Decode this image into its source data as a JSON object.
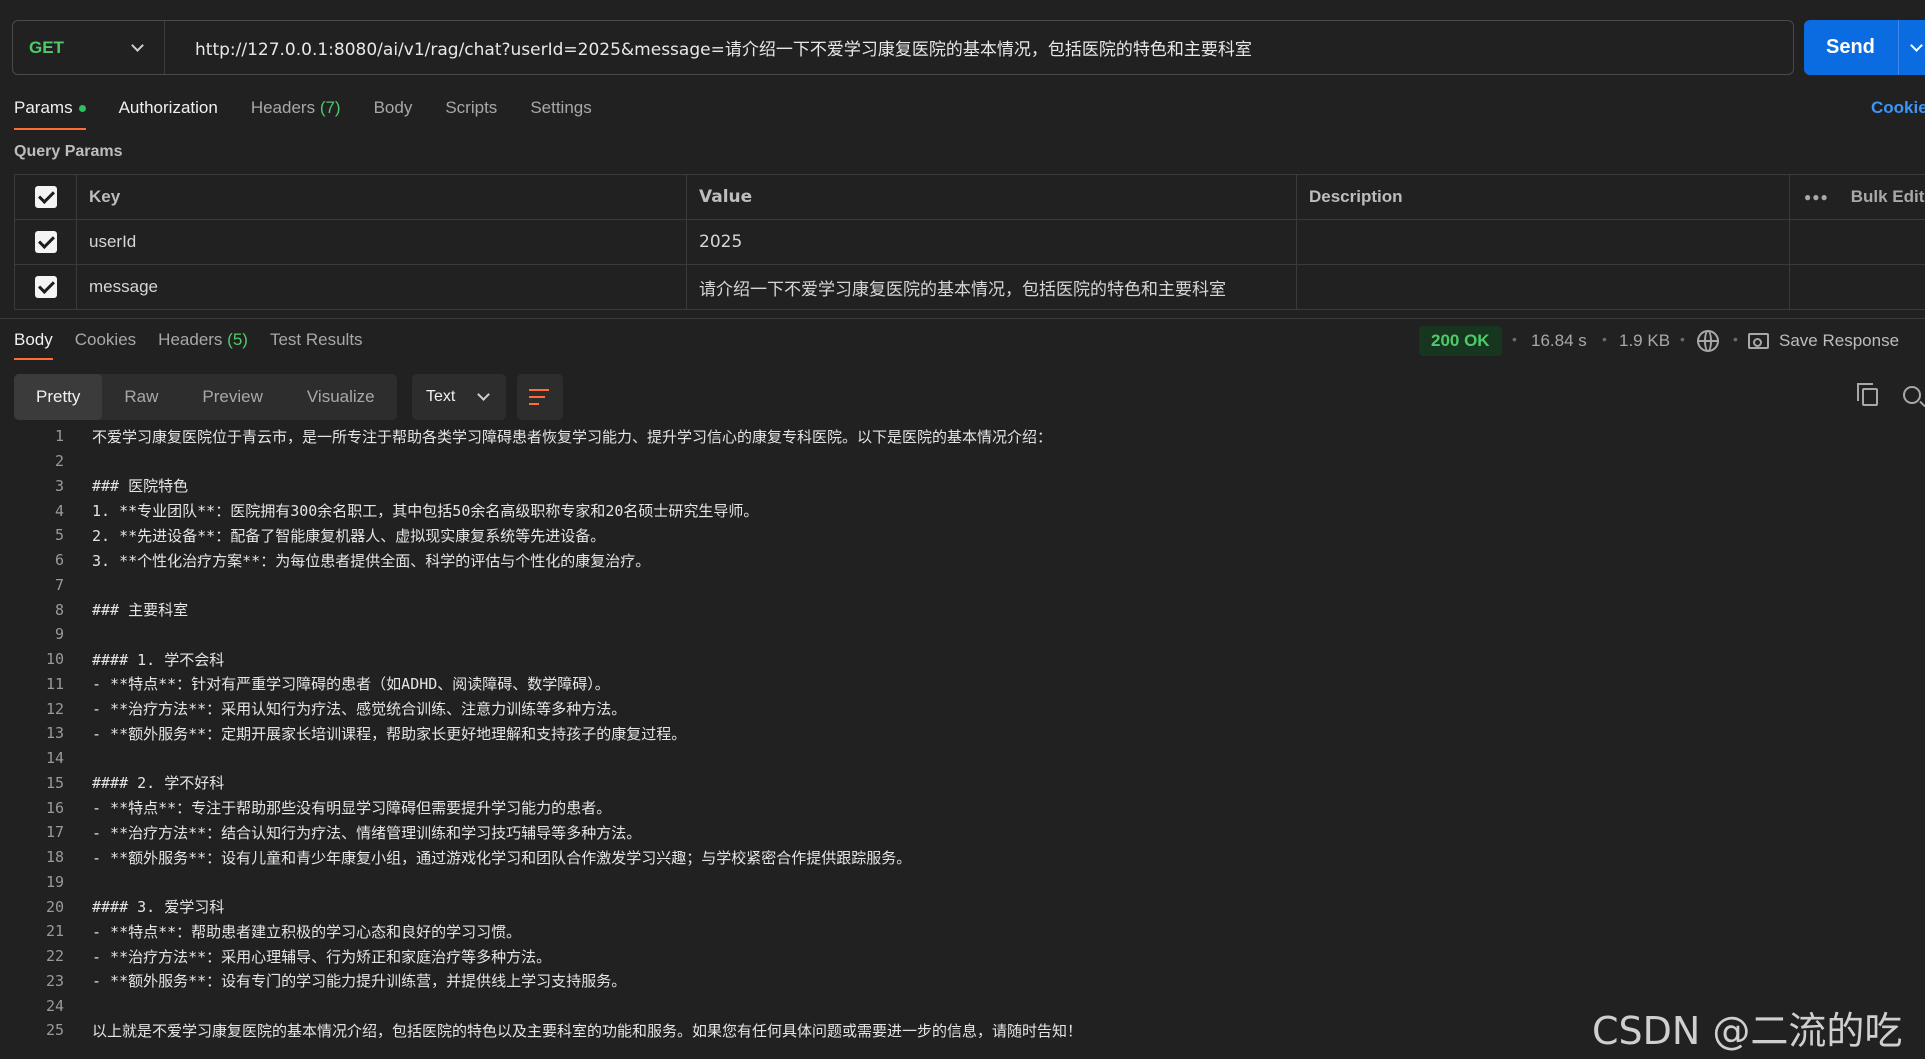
{
  "request": {
    "method": "GET",
    "url": "http://127.0.0.1:8080/ai/v1/rag/chat?userId=2025&message=请介绍一下不爱学习康复医院的基本情况，包括医院的特色和主要科室",
    "send_label": "Send"
  },
  "request_tabs": {
    "params": "Params",
    "authorization": "Authorization",
    "headers": "Headers",
    "headers_count": "(7)",
    "body": "Body",
    "scripts": "Scripts",
    "settings": "Settings",
    "cookies": "Cookie"
  },
  "query_params": {
    "title": "Query Params",
    "columns": {
      "key": "Key",
      "value": "Value",
      "description": "Description",
      "bulk_edit": "Bulk Edit"
    },
    "rows": [
      {
        "key": "userId",
        "value": "2025",
        "description": ""
      },
      {
        "key": "message",
        "value": "请介绍一下不爱学习康复医院的基本情况，包括医院的特色和主要科室",
        "description": ""
      }
    ]
  },
  "response_tabs": {
    "body": "Body",
    "cookies": "Cookies",
    "headers": "Headers",
    "headers_count": "(5)",
    "test_results": "Test Results"
  },
  "response_meta": {
    "status": "200 OK",
    "time": "16.84 s",
    "size": "1.9 KB",
    "save_response": "Save Response"
  },
  "view": {
    "pretty": "Pretty",
    "raw": "Raw",
    "preview": "Preview",
    "visualize": "Visualize",
    "format": "Text"
  },
  "code_lines": [
    "不爱学习康复医院位于青云市，是一所专注于帮助各类学习障碍患者恢复学习能力、提升学习信心的康复专科医院。以下是医院的基本情况介绍：",
    "",
    "### 医院特色",
    "1. **专业团队**：医院拥有300余名职工，其中包括50余名高级职称专家和20名硕士研究生导师。",
    "2. **先进设备**：配备了智能康复机器人、虚拟现实康复系统等先进设备。",
    "3. **个性化治疗方案**：为每位患者提供全面、科学的评估与个性化的康复治疗。",
    "",
    "### 主要科室",
    "",
    "#### 1. 学不会科",
    "- **特点**：针对有严重学习障碍的患者（如ADHD、阅读障碍、数学障碍）。",
    "- **治疗方法**：采用认知行为疗法、感觉统合训练、注意力训练等多种方法。",
    "- **额外服务**：定期开展家长培训课程，帮助家长更好地理解和支持孩子的康复过程。",
    "",
    "#### 2. 学不好科",
    "- **特点**：专注于帮助那些没有明显学习障碍但需要提升学习能力的患者。",
    "- **治疗方法**：结合认知行为疗法、情绪管理训练和学习技巧辅导等多种方法。",
    "- **额外服务**：设有儿童和青少年康复小组，通过游戏化学习和团队合作激发学习兴趣；与学校紧密合作提供跟踪服务。",
    "",
    "#### 3. 爱学习科",
    "- **特点**：帮助患者建立积极的学习心态和良好的学习习惯。",
    "- **治疗方法**：采用心理辅导、行为矫正和家庭治疗等多种方法。",
    "- **额外服务**：设有专门的学习能力提升训练营，并提供线上学习支持服务。",
    "",
    "以上就是不爱学习康复医院的基本情况介绍，包括医院的特色以及主要科室的功能和服务。如果您有任何具体问题或需要进一步的信息，请随时告知！"
  ],
  "watermark": "CSDN @二流的吃货",
  "colors": {
    "accent": "#ff6c37",
    "send": "#0b6be0",
    "ok": "#4fc96a"
  }
}
